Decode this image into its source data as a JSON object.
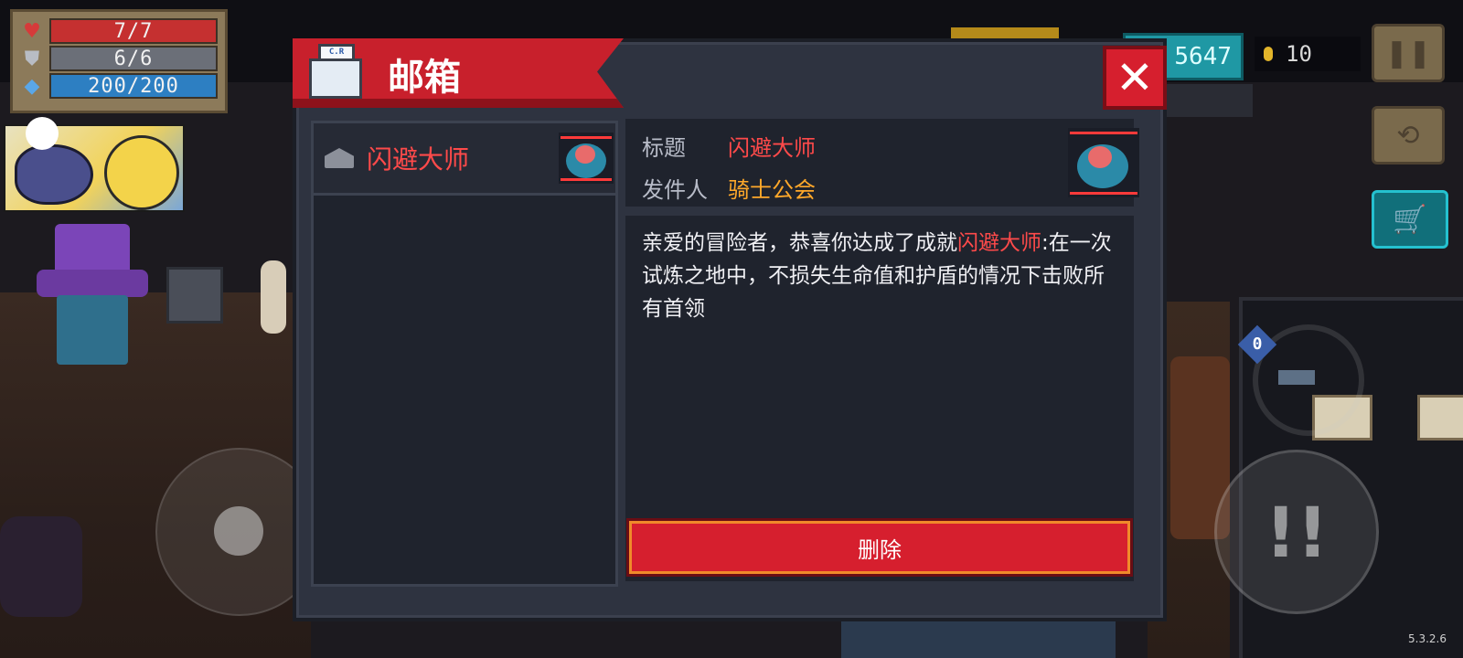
{
  "hud": {
    "hp": "7/7",
    "armor": "6/6",
    "energy": "200/200",
    "gems": "5647",
    "gold": "10",
    "version": "5.3.2.6",
    "ammo": "0"
  },
  "mailbox": {
    "title": "邮箱",
    "mail_icon_text": "C.R MAIL",
    "close_label": "✕",
    "list": [
      {
        "label": "闪避大师"
      }
    ],
    "detail": {
      "subject_label": "标题",
      "subject_value": "闪避大师",
      "sender_label": "发件人",
      "sender_value": "骑士公会",
      "body_prefix": "亲爱的冒险者，恭喜你达成了成就",
      "body_highlight": "闪避大师",
      "body_suffix": ":在一次试炼之地中，不损失生命值和护盾的情况下击败所有首领"
    },
    "delete_label": "删除"
  },
  "colors": {
    "accent_red": "#d61f2e",
    "highlight_red": "#ff4a4a",
    "sender_orange": "#ffa82a",
    "panel_bg": "#1f232d"
  },
  "icons": [
    "heart-icon",
    "shield-icon",
    "energy-icon",
    "coin-icon",
    "pause-icon",
    "switch-weapon-icon",
    "cart-icon",
    "mail-icon",
    "envelope-icon",
    "close-icon"
  ]
}
